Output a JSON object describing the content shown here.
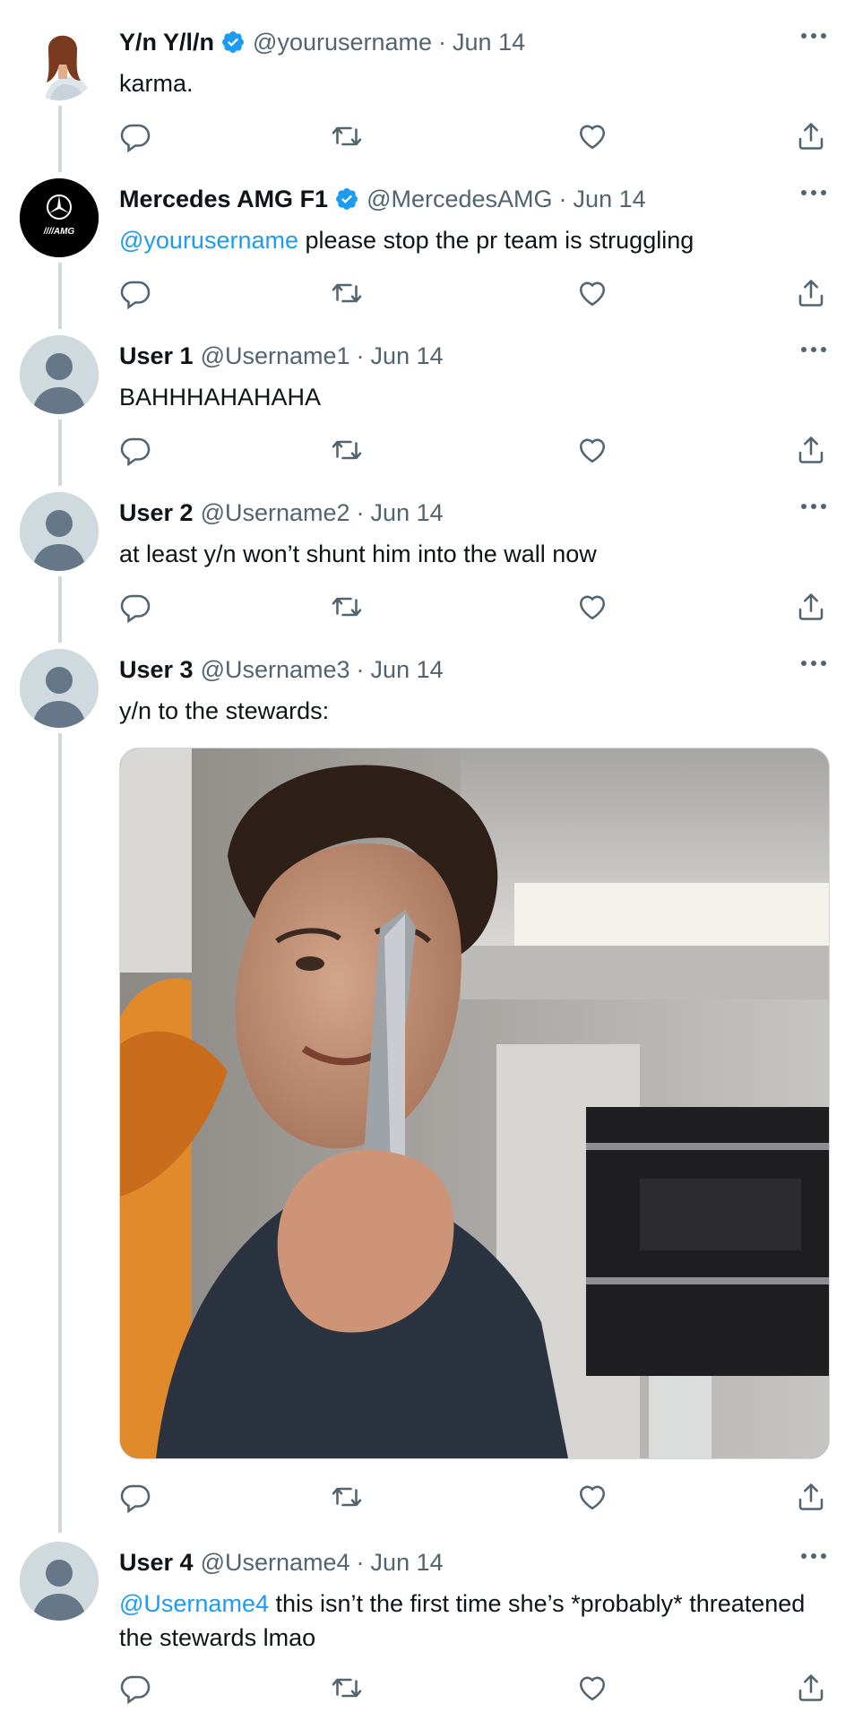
{
  "tweets": [
    {
      "name": "Y/n Y/l/n",
      "verified": true,
      "handle": "@yourusername",
      "separator": "·",
      "date": "Jun 14",
      "text": "karma.",
      "avatar": "profile-photo"
    },
    {
      "name": "Mercedes AMG F1",
      "verified": true,
      "handle": "@MercedesAMG",
      "separator": "·",
      "date": "Jun 14",
      "mention": "@yourusername",
      "text": " please stop the pr team is struggling",
      "avatar": "mercedes-amg-logo"
    },
    {
      "name": "User 1",
      "handle": "@Username1",
      "separator": "·",
      "date": "Jun 14",
      "text": "BAHHHAHAHAHA",
      "avatar": "default-avatar"
    },
    {
      "name": "User 2",
      "handle": "@Username2",
      "separator": "·",
      "date": "Jun 14",
      "text": "at least y/n won’t shunt him into the wall now",
      "avatar": "default-avatar"
    },
    {
      "name": "User 3",
      "handle": "@Username3",
      "separator": "·",
      "date": "Jun 14",
      "text": "y/n to the stewards:",
      "avatar": "default-avatar",
      "media": "photo of a person holding up a knife in a kitchen"
    },
    {
      "name": "User 4",
      "handle": "@Username4",
      "separator": "·",
      "date": "Jun 14",
      "mention": "@Username4",
      "text": " this isn’t the first time she’s *probably* threatened the stewards lmao",
      "avatar": "default-avatar"
    }
  ],
  "icons": [
    "reply-icon",
    "retweet-icon",
    "like-icon",
    "share-icon",
    "more-icon",
    "verified-badge-icon"
  ],
  "colors": {
    "accent": "#1d9bf0",
    "secondary_text": "#536471",
    "thread_line": "#cfd9de",
    "primary_text": "#0f1419"
  }
}
